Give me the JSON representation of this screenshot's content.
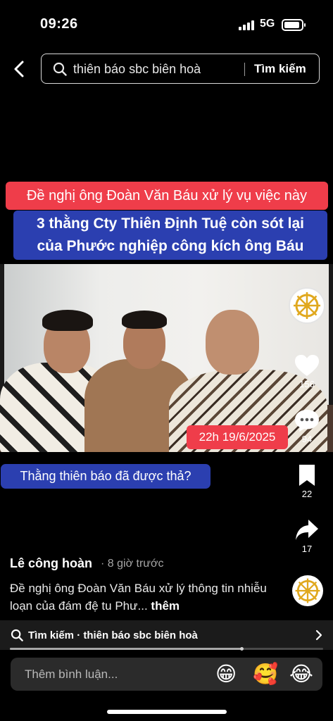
{
  "status_bar": {
    "time": "09:26",
    "network": "5G",
    "battery_level": 0.85
  },
  "header": {
    "back_icon": "chevron-left-icon",
    "search_icon": "search-icon",
    "search_query": "thiên báo sbc biên hoà",
    "search_button": "Tìm kiếm"
  },
  "video": {
    "caption_red": "Đề nghị ông Đoàn Văn Báu xử lý vụ việc này",
    "caption_blue_line1": "3 thằng Cty Thiên Định Tuệ còn sót lại",
    "caption_blue_line2": "của Phước nghiệp công kích ông Báu",
    "date_tag": "22h 19/6/2025",
    "question_caption": "Thằng thiên báo đã được thả?"
  },
  "rail": {
    "likes": "156",
    "comments": "94",
    "saves": "22",
    "shares": "17",
    "avatar_icon": "dharma-wheel-icon"
  },
  "post": {
    "author": "Lê công hoàn",
    "time_ago": "· 8 giờ trước",
    "description": "Đề nghị ông Đoàn Văn Báu xử lý thông tin nhiễu loạn của đám đệ tu Phư...",
    "more": "thêm"
  },
  "related_search": {
    "text": "Tìm kiếm · thiên báo sbc biên hoà",
    "progress": 0.74
  },
  "comment_bar": {
    "placeholder": "Thêm bình luận...",
    "emojis": [
      "😁",
      "🥰",
      "😂"
    ]
  },
  "colors": {
    "caption_red": "#ef3d4a",
    "caption_blue": "#2b3fb0",
    "dharma_gold": "#e0a81e"
  }
}
